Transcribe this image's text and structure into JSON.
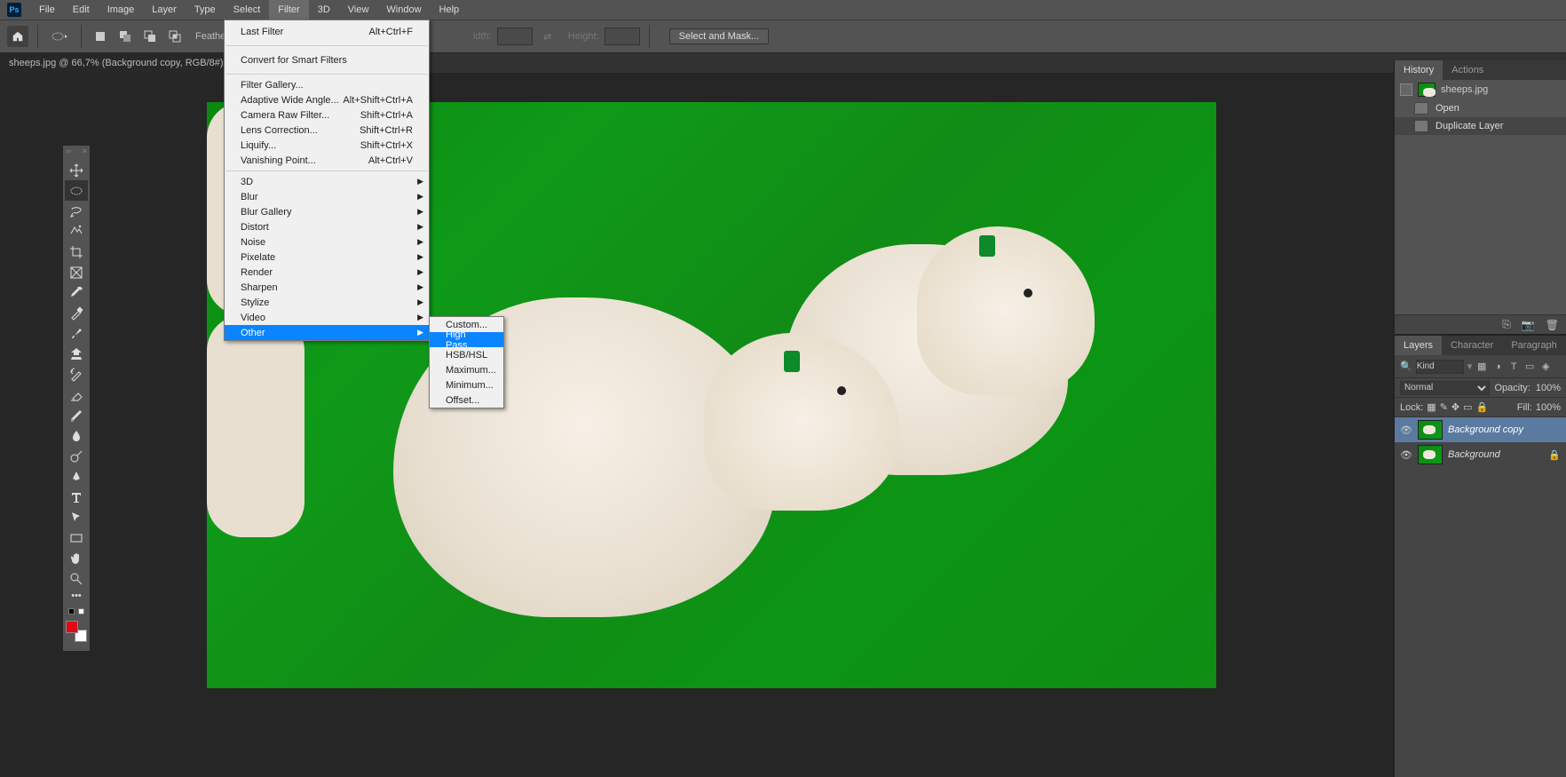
{
  "menubar": [
    "File",
    "Edit",
    "Image",
    "Layer",
    "Type",
    "Select",
    "Filter",
    "3D",
    "View",
    "Window",
    "Help"
  ],
  "menubar_active": "Filter",
  "optbar": {
    "feather": "Feather:",
    "width": "idth:",
    "height": "Height:",
    "mask": "Select and Mask..."
  },
  "doc_tab": "sheeps.jpg @ 66,7% (Background copy, RGB/8#) *",
  "filter_menu": {
    "last": {
      "label": "Last Filter",
      "sc": "Alt+Ctrl+F"
    },
    "smart": "Convert for Smart Filters",
    "gallery": "Filter Gallery...",
    "wide": {
      "label": "Adaptive Wide Angle...",
      "sc": "Alt+Shift+Ctrl+A"
    },
    "raw": {
      "label": "Camera Raw Filter...",
      "sc": "Shift+Ctrl+A"
    },
    "lens": {
      "label": "Lens Correction...",
      "sc": "Shift+Ctrl+R"
    },
    "liquify": {
      "label": "Liquify...",
      "sc": "Shift+Ctrl+X"
    },
    "vanish": {
      "label": "Vanishing Point...",
      "sc": "Alt+Ctrl+V"
    },
    "subs": [
      "3D",
      "Blur",
      "Blur Gallery",
      "Distort",
      "Noise",
      "Pixelate",
      "Render",
      "Sharpen",
      "Stylize",
      "Video",
      "Other"
    ]
  },
  "other_sub": [
    "Custom...",
    "High Pass...",
    "HSB/HSL",
    "Maximum...",
    "Minimum...",
    "Offset..."
  ],
  "other_hi": "High Pass...",
  "history": {
    "tab1": "History",
    "tab2": "Actions",
    "doc": "sheeps.jpg",
    "items": [
      "Open",
      "Duplicate Layer"
    ]
  },
  "layers": {
    "tabs": [
      "Layers",
      "Character",
      "Paragraph"
    ],
    "kind": "Kind",
    "mode": "Normal",
    "opacity_l": "Opacity:",
    "opacity_v": "100%",
    "lock_l": "Lock:",
    "fill_l": "Fill:",
    "fill_v": "100%",
    "items": [
      {
        "name": "Background copy",
        "sel": true,
        "locked": false
      },
      {
        "name": "Background",
        "sel": false,
        "locked": true
      }
    ]
  }
}
